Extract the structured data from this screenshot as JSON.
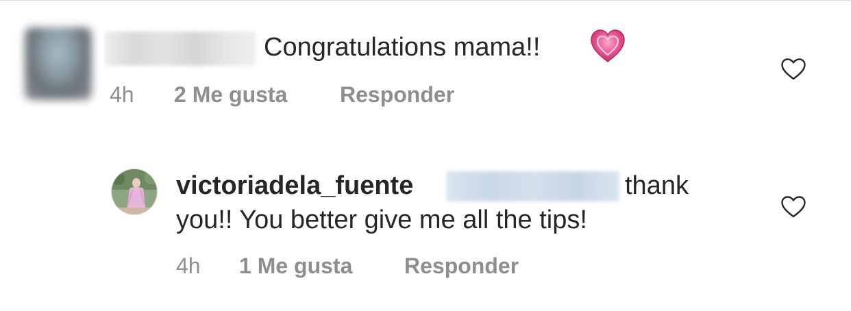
{
  "comment": {
    "text": "Congratulations mama!! ",
    "emoji": "heart-emoji-pink",
    "time": "4h",
    "likes": "2 Me gusta",
    "reply_label": "Responder"
  },
  "reply": {
    "username": "victoriadela_fuente",
    "text_tail": "thank",
    "text_line2": "you!! You better give me all the tips!",
    "time": "4h",
    "likes": "1 Me gusta",
    "reply_label": "Responder"
  },
  "icons": {
    "like": "heart-outline-icon"
  },
  "colors": {
    "text": "#262626",
    "meta": "#8e8e8e",
    "heart_emoji": "#e8508f"
  }
}
